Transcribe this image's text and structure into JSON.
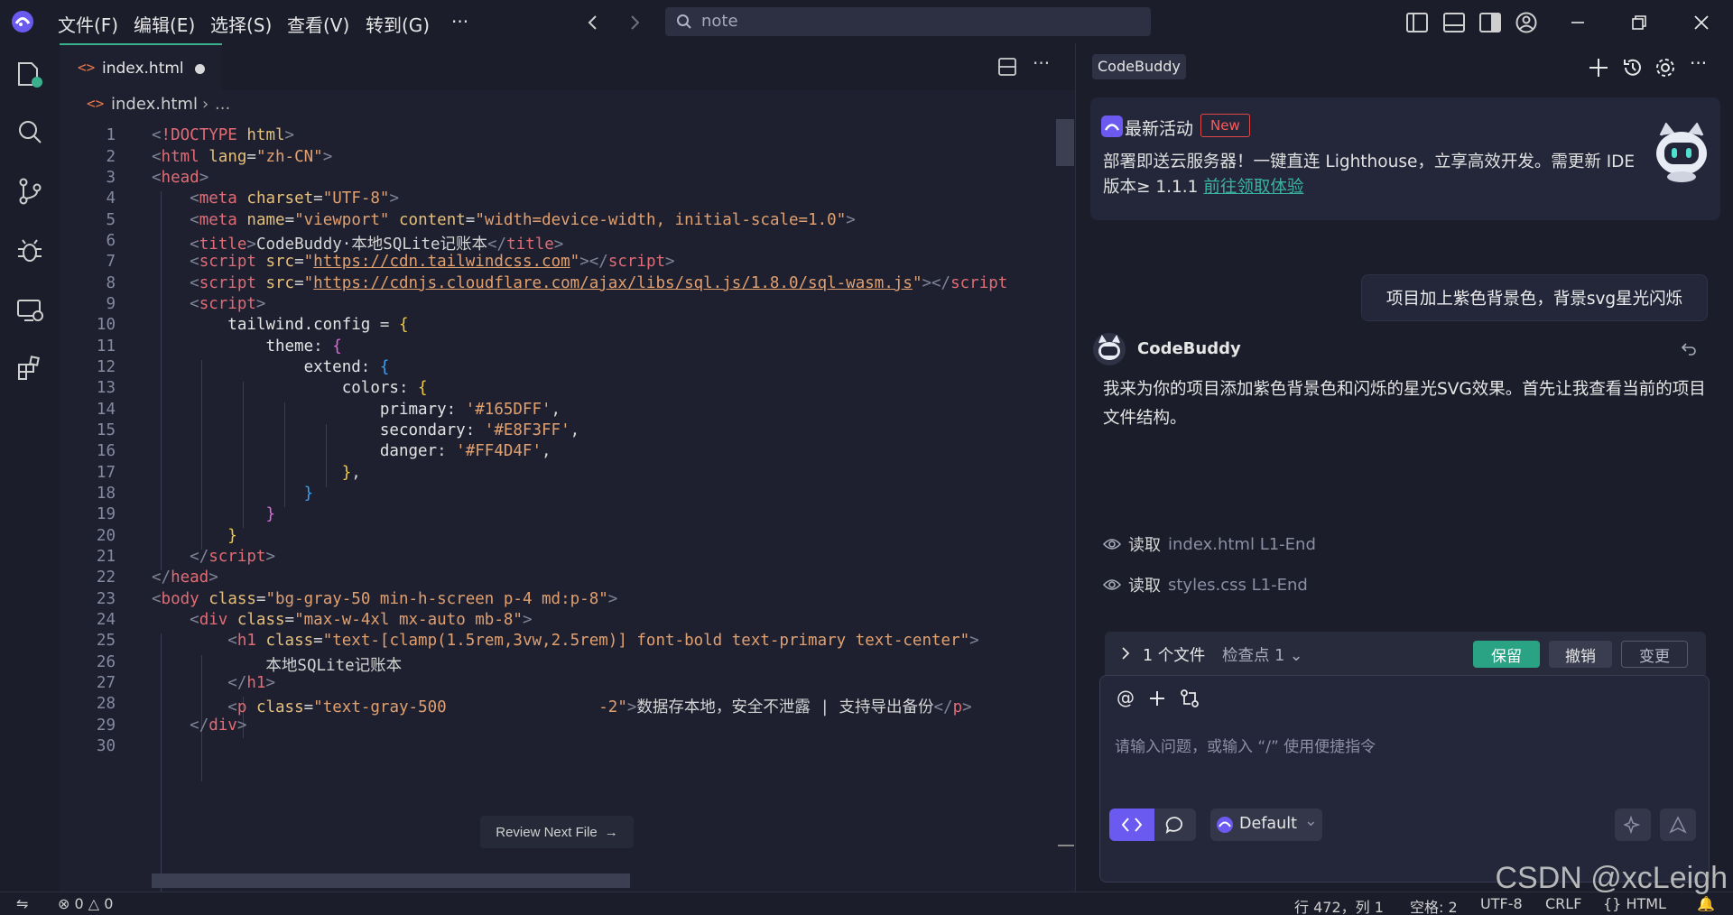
{
  "titlebar": {
    "menu": [
      "文件(F)",
      "编辑(E)",
      "选择(S)",
      "查看(V)",
      "转到(G)",
      "···"
    ],
    "search": "note"
  },
  "editor": {
    "tab_name": "index.html",
    "breadcrumb": "index.html",
    "breadcrumb_more": "...",
    "review_label": "Review Next File",
    "line_numbers": [
      "1",
      "2",
      "3",
      "4",
      "5",
      "6",
      "7",
      "8",
      "9",
      "10",
      "11",
      "12",
      "13",
      "14",
      "15",
      "16",
      "17",
      "18",
      "19",
      "20",
      "21",
      "22",
      "23",
      "24",
      "25",
      "26",
      "27",
      "28",
      "29",
      "30"
    ]
  },
  "panel": {
    "title": "CodeBuddy",
    "promo": {
      "title": "最新活动",
      "badge": "New",
      "body": "部署即送云服务器！一键直连 Lighthouse，立享高效开发。需更新 IDE 版本≥ 1.1.1 ",
      "link": "前往领取体验"
    },
    "user_message": "项目加上紫色背景色，背景svg星光闪烁",
    "bot_name": "CodeBuddy",
    "bot_message": "我来为你的项目添加紫色背景色和闪烁的星光SVG效果。首先让我查看当前的项目文件结构。",
    "reads": [
      {
        "label": "读取",
        "file": "index.html L1-End"
      },
      {
        "label": "读取",
        "file": "styles.css L1-End"
      }
    ],
    "changes": {
      "files": "1 个文件",
      "checkpoint": "检查点 1",
      "keep": "保留",
      "undo": "撤销",
      "diff": "变更"
    },
    "input_placeholder": "请输入问题，或输入 “/” 使用便捷指令",
    "model": "Default"
  },
  "statusbar": {
    "errors": "0",
    "warnings": "0",
    "position": "行 472，列 1",
    "spaces": "空格: 2",
    "encoding": "UTF-8",
    "eol": "CRLF",
    "language": "{} HTML"
  },
  "watermark": "CSDN @xcLeigh",
  "colors": {
    "accent": "#3bb08f",
    "primary": "#6a5af0",
    "danger": "#e04848"
  }
}
